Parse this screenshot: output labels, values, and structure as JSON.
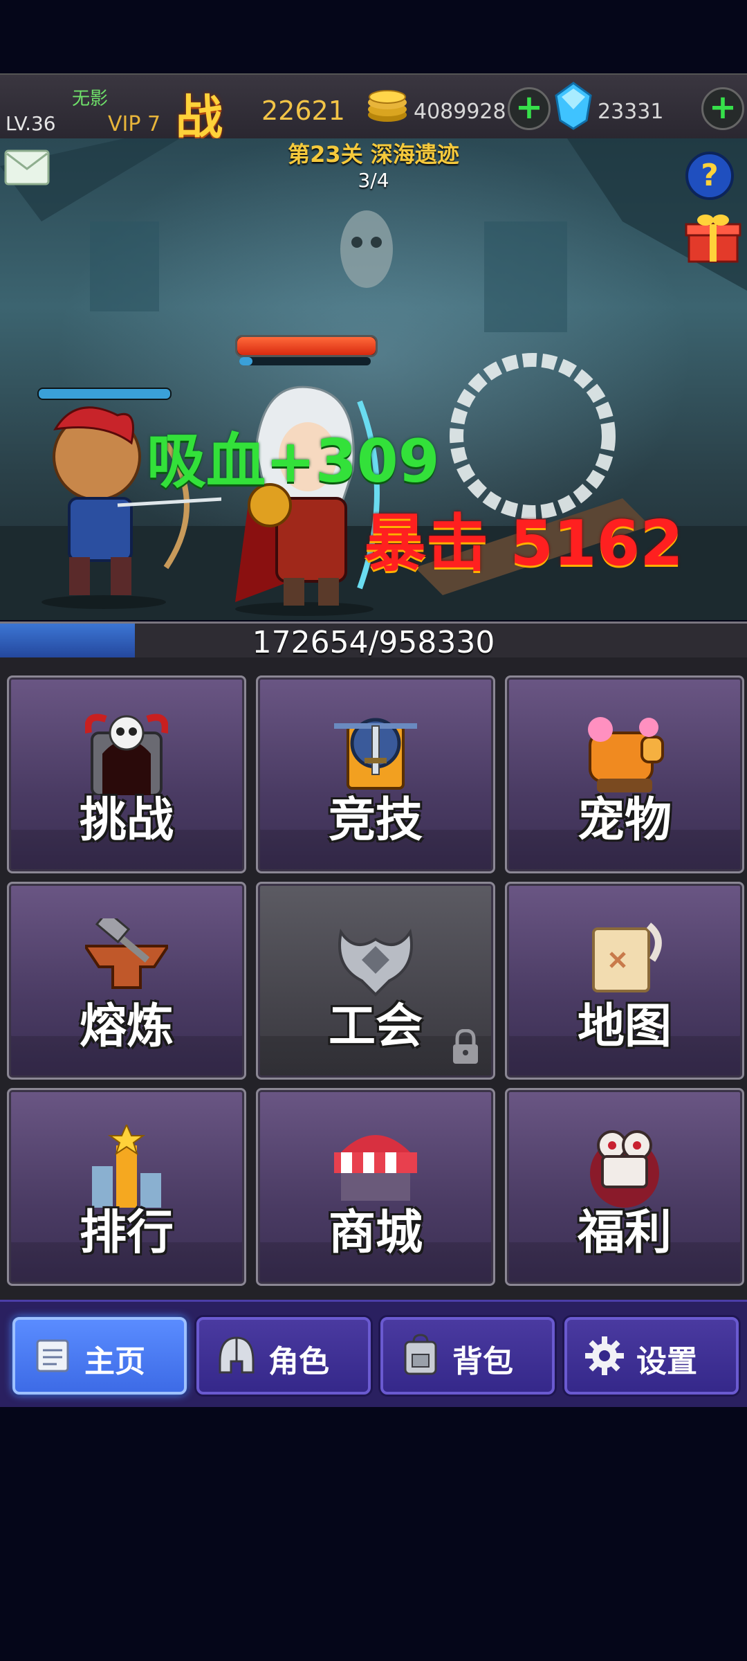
{
  "player": {
    "name": "无影",
    "level": "LV.36",
    "vip": "VIP 7",
    "power_icon": "战",
    "power": "22621",
    "gold": "4089928",
    "gems": "23331"
  },
  "stage": {
    "title": "第23关 深海遗迹",
    "progress": "3/4"
  },
  "battle": {
    "lifesteal_text": "吸血+309",
    "crit_text": "暴击 5162"
  },
  "exp": {
    "text": "172654/958330",
    "current": 172654,
    "max": 958330
  },
  "menu": {
    "items": [
      {
        "label": "挑战",
        "icon": "skull-gate-icon",
        "locked": false
      },
      {
        "label": "竞技",
        "icon": "sword-shield-icon",
        "locked": false
      },
      {
        "label": "宠物",
        "icon": "pet-cannon-icon",
        "locked": false
      },
      {
        "label": "熔炼",
        "icon": "anvil-hammer-icon",
        "locked": false
      },
      {
        "label": "工会",
        "icon": "guild-crest-icon",
        "locked": true
      },
      {
        "label": "地图",
        "icon": "scroll-map-icon",
        "locked": false
      },
      {
        "label": "排行",
        "icon": "ranking-star-icon",
        "locked": false
      },
      {
        "label": "商城",
        "icon": "shop-awning-icon",
        "locked": false
      },
      {
        "label": "福利",
        "icon": "film-camera-icon",
        "locked": false
      }
    ]
  },
  "nav": {
    "items": [
      {
        "label": "主页",
        "icon": "scroll-home-icon",
        "active": true
      },
      {
        "label": "角色",
        "icon": "helmet-icon",
        "active": false
      },
      {
        "label": "背包",
        "icon": "backpack-icon",
        "active": false
      },
      {
        "label": "设置",
        "icon": "gear-icon",
        "active": false
      }
    ]
  },
  "colors": {
    "gold_text": "#f2c447",
    "lifesteal": "#33e13a",
    "crit": "#ff2020",
    "tile_purple": "#4a3b63",
    "nav_active": "#3d6be6"
  }
}
